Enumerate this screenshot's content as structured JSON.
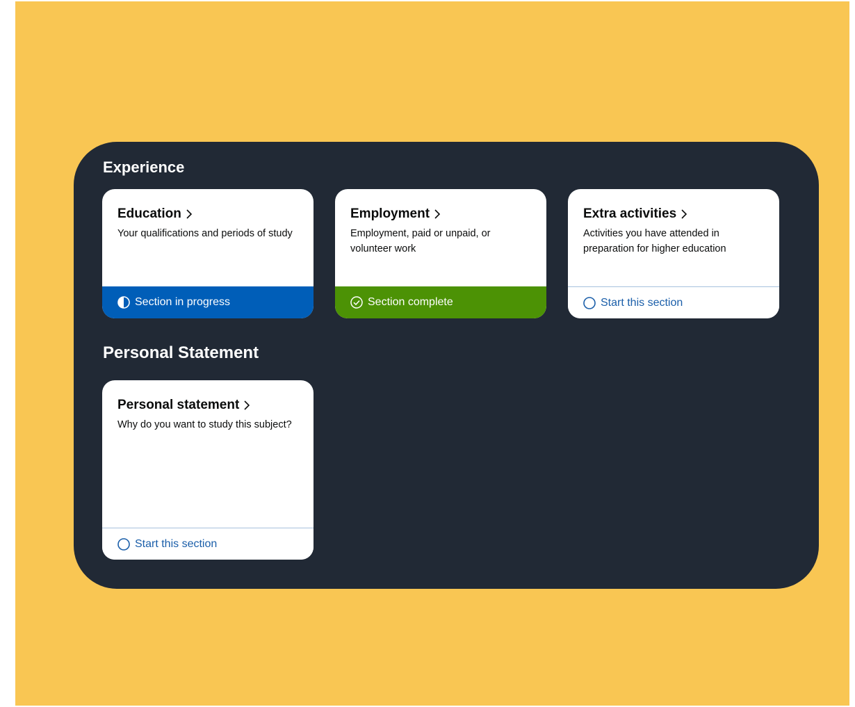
{
  "sections": [
    {
      "title": "Experience",
      "cards": [
        {
          "title": "Education",
          "description": "Your qualifications and periods of study",
          "status": {
            "label": "Section in progress",
            "state": "in-progress",
            "icon": "half-circle-icon",
            "color": "#005eb8"
          }
        },
        {
          "title": "Employment",
          "description": "Employment, paid or unpaid, or volunteer work",
          "status": {
            "label": "Section complete",
            "state": "complete",
            "icon": "check-circle-icon",
            "color": "#4c9205"
          }
        },
        {
          "title": "Extra activities",
          "description": "Activities you have attended in preparation for higher education",
          "status": {
            "label": "Start this section",
            "state": "not-started",
            "icon": "empty-circle-icon",
            "color": "#1a5ea9"
          }
        }
      ]
    },
    {
      "title": "Personal Statement",
      "cards": [
        {
          "title": "Personal statement",
          "description": "Why do you want to study this subject?",
          "status": {
            "label": "Start this section",
            "state": "not-started",
            "icon": "empty-circle-icon",
            "color": "#1a5ea9"
          }
        }
      ]
    }
  ],
  "theme": {
    "background": "#f9c653",
    "panel": "#212935",
    "card": "#ffffff"
  }
}
